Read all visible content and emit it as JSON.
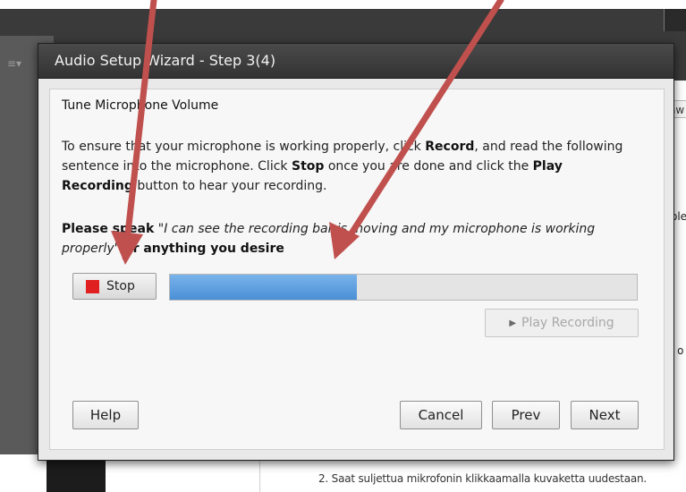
{
  "background": {
    "right_snippets": [
      "aw",
      "ole",
      "l o"
    ],
    "bottom_text": "2.   Saat suljettua mikrofonin klikkaamalla kuvaketta uudestaan."
  },
  "dialog": {
    "title": "Audio Setup Wizard - Step 3(4)",
    "heading": "Tune Microphone Volume",
    "instructions": {
      "t1": "To ensure that your microphone is working properly, click ",
      "record": "Record",
      "t2": ", and read the following sentence into the microphone. Click ",
      "stop": "Stop",
      "t3": " once you are done and click the ",
      "play": "Play Recording",
      "t4": " button to hear your recording."
    },
    "speak": {
      "lead": "Please speak",
      "quote": " \"I can see the recording bar is moving and my microphone is working properly\"",
      "tail": " or anything you desire"
    },
    "stop_button": "Stop",
    "meter_level": 0.4,
    "play_recording_button": "Play Recording",
    "help_button": "Help",
    "cancel_button": "Cancel",
    "prev_button": "Prev",
    "next_button": "Next"
  },
  "colors": {
    "annotation_arrow": "#c0504d",
    "meter_fill": "#4a8fd6",
    "stop_icon": "#e02020"
  }
}
